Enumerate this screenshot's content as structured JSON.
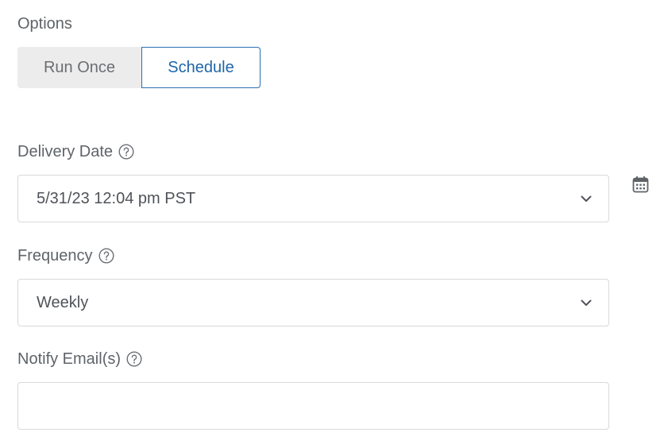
{
  "options": {
    "label": "Options",
    "run_once_label": "Run Once",
    "schedule_label": "Schedule"
  },
  "delivery_date": {
    "label": "Delivery Date",
    "value": "5/31/23 12:04 pm PST"
  },
  "frequency": {
    "label": "Frequency",
    "value": "Weekly"
  },
  "notify_emails": {
    "label": "Notify Email(s)",
    "value": ""
  },
  "icons": {
    "help": "question-circle-icon",
    "dropdown": "chevron-down-icon",
    "calendar": "calendar-icon"
  },
  "colors": {
    "accent": "#1f65a8",
    "accent_border": "#2a6fb1",
    "segment_inactive_bg": "#ececec",
    "field_border": "#d7d9dc",
    "label_text": "#5f6368"
  }
}
